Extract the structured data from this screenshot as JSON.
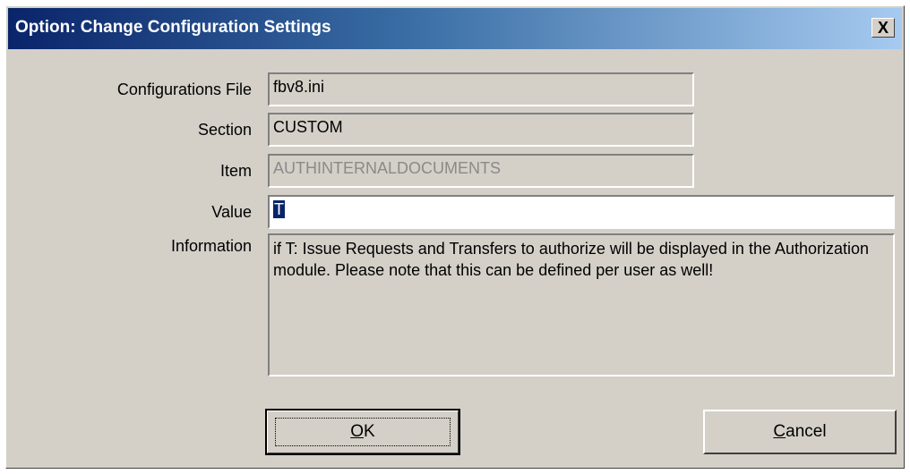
{
  "window": {
    "title": "Option: Change Configuration Settings",
    "close_label": "X"
  },
  "fields": {
    "config_file": {
      "label": "Configurations File",
      "value": "fbv8.ini"
    },
    "section": {
      "label": "Section",
      "value": "CUSTOM"
    },
    "item": {
      "label": "Item",
      "value": "AUTHINTERNALDOCUMENTS"
    },
    "value": {
      "label": "Value",
      "value": "T"
    },
    "information": {
      "label": "Information",
      "value": "if T: Issue Requests and Transfers to authorize will be displayed in the Authorization module. Please note that this can be defined per user as well!"
    }
  },
  "buttons": {
    "ok": {
      "mnemonic": "O",
      "rest": "K"
    },
    "cancel": {
      "mnemonic": "C",
      "rest": "ancel"
    }
  }
}
